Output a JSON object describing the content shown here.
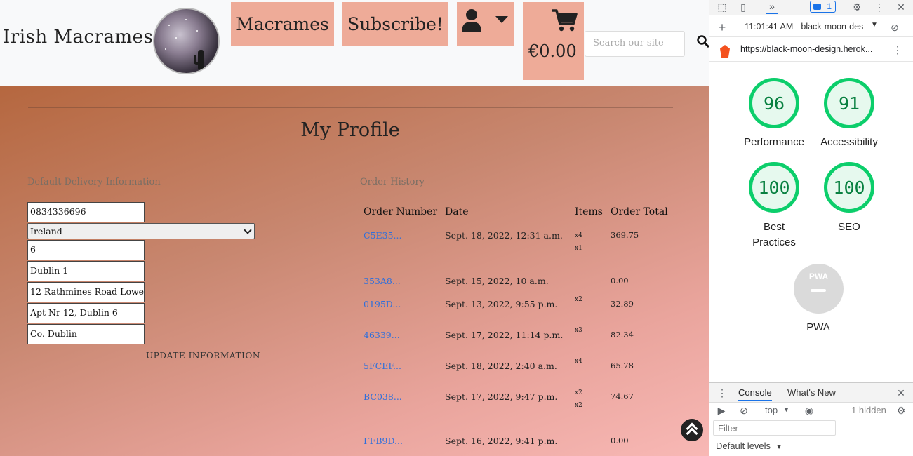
{
  "site": {
    "brand": "Irish Macrames",
    "nav": {
      "macrames": "Macrames",
      "subscribe": "Subscribe!",
      "cart_total": "€0.00"
    },
    "search": {
      "placeholder": "Search our site"
    },
    "page_title": "My Profile",
    "delivery": {
      "heading": "Default Delivery Information",
      "phone": "0834336696",
      "country": "Ireland",
      "postcode": "6",
      "town": "Dublin 1",
      "street1": "12 Rathmines Road Lowe",
      "street2": "Apt Nr 12, Dublin 6",
      "county": "Co. Dublin",
      "update_label": "UPDATE INFORMATION"
    },
    "history": {
      "heading": "Order History",
      "columns": [
        "Order Number",
        "Date",
        "Items",
        "Order Total"
      ],
      "rows": [
        {
          "number": "C5E35...",
          "date": "Sept. 18, 2022, 12:31 a.m.",
          "items": [
            "x4",
            "x1"
          ],
          "total": "369.75"
        },
        {
          "number": "353A8...",
          "date": "Sept. 15, 2022, 10 a.m.",
          "items": [],
          "total": "0.00"
        },
        {
          "number": "0195D...",
          "date": "Sept. 13, 2022, 9:55 p.m.",
          "items": [
            "x2"
          ],
          "total": "32.89"
        },
        {
          "number": "46339...",
          "date": "Sept. 17, 2022, 11:14 p.m.",
          "items": [
            "x3"
          ],
          "total": "82.34"
        },
        {
          "number": "5FCEF...",
          "date": "Sept. 18, 2022, 2:40 a.m.",
          "items": [
            "x4"
          ],
          "total": "65.78"
        },
        {
          "number": "BC038...",
          "date": "Sept. 17, 2022, 9:47 p.m.",
          "items": [
            "x2",
            "x2"
          ],
          "total": "74.67"
        },
        {
          "number": "FFB9D...",
          "date": "Sept. 16, 2022, 9:41 p.m.",
          "items": [],
          "total": "0.00"
        }
      ]
    },
    "colors": {
      "nav_button": "#eeab98",
      "link": "#2f6fdb"
    }
  },
  "devtools": {
    "issues_count": "1",
    "report_time": "11:01:41 AM - black-moon-des",
    "url": "https://black-moon-design.herok...",
    "scores": [
      {
        "value": "96",
        "label": "Performance"
      },
      {
        "value": "91",
        "label": "Accessibility"
      },
      {
        "value": "100",
        "label": "Best Practices"
      },
      {
        "value": "100",
        "label": "SEO"
      }
    ],
    "pwa": {
      "badge": "PWA",
      "label": "PWA"
    },
    "drawer": {
      "tab_console": "Console",
      "tab_whats_new": "What's New",
      "context": "top",
      "hidden": "1 hidden",
      "filter_placeholder": "Filter",
      "levels": "Default levels"
    },
    "colors": {
      "pass": "#0cce6b",
      "accent": "#1a73e8"
    }
  }
}
